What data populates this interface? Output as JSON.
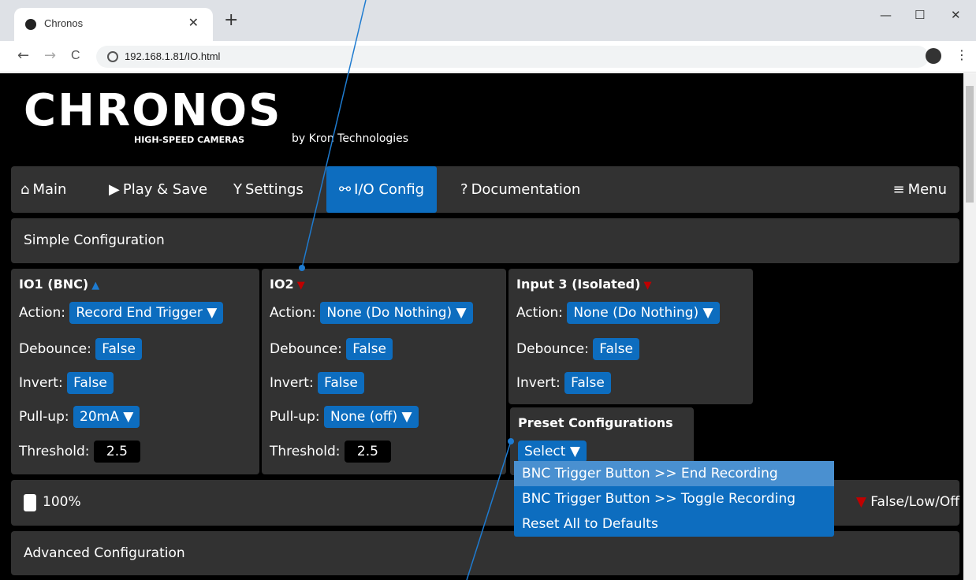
{
  "browser": {
    "tab_title": "Chronos",
    "tab_close": "✕",
    "new_tab": "+",
    "url": "192.168.1.81/IO.html",
    "back": "←",
    "forward": "→",
    "reload": "C",
    "minimize": "—",
    "maximize": "☐",
    "close": "✕"
  },
  "header": {
    "logo": "CHRONOS",
    "logo_sub": "HIGH-SPEED CAMERAS",
    "byline": "by Kron Technologies"
  },
  "nav": {
    "main": "Main",
    "play_save": "Play & Save",
    "settings": "Settings",
    "io_config": "I/O Config",
    "documentation": "Documentation",
    "menu": "Menu"
  },
  "simple_config": "Simple Configuration",
  "labels": {
    "action": "Action:",
    "debounce": "Debounce:",
    "invert": "Invert:",
    "pullup": "Pull-up:",
    "threshold": "Threshold:"
  },
  "io1": {
    "title": "IO1 (BNC)",
    "action": "Record End Trigger",
    "debounce": "False",
    "invert": "False",
    "pullup": "20mA",
    "threshold": "2.5",
    "state_color": "#1e7bd0"
  },
  "io2": {
    "title": "IO2",
    "action": "None (Do Nothing)",
    "debounce": "False",
    "invert": "False",
    "pullup": "None (off)",
    "threshold": "2.5",
    "state_color": "#c00000"
  },
  "input3": {
    "title": "Input 3 (Isolated)",
    "action": "None (Do Nothing)",
    "debounce": "False",
    "invert": "False",
    "state_color": "#c00000"
  },
  "preset": {
    "title": "Preset Configurations",
    "select": "Select",
    "options": [
      "BNC Trigger Button >> End Recording",
      "BNC Trigger Button >> Toggle Recording",
      "Reset All to Defaults"
    ]
  },
  "status": {
    "battery": "100%",
    "legend": "False/Low/Off"
  },
  "advanced_config": "Advanced Configuration",
  "colors": {
    "accent": "#0d6dbf",
    "panel": "#323232",
    "background": "#000000",
    "low_state": "#c00000",
    "high_state": "#1e7bd0"
  }
}
